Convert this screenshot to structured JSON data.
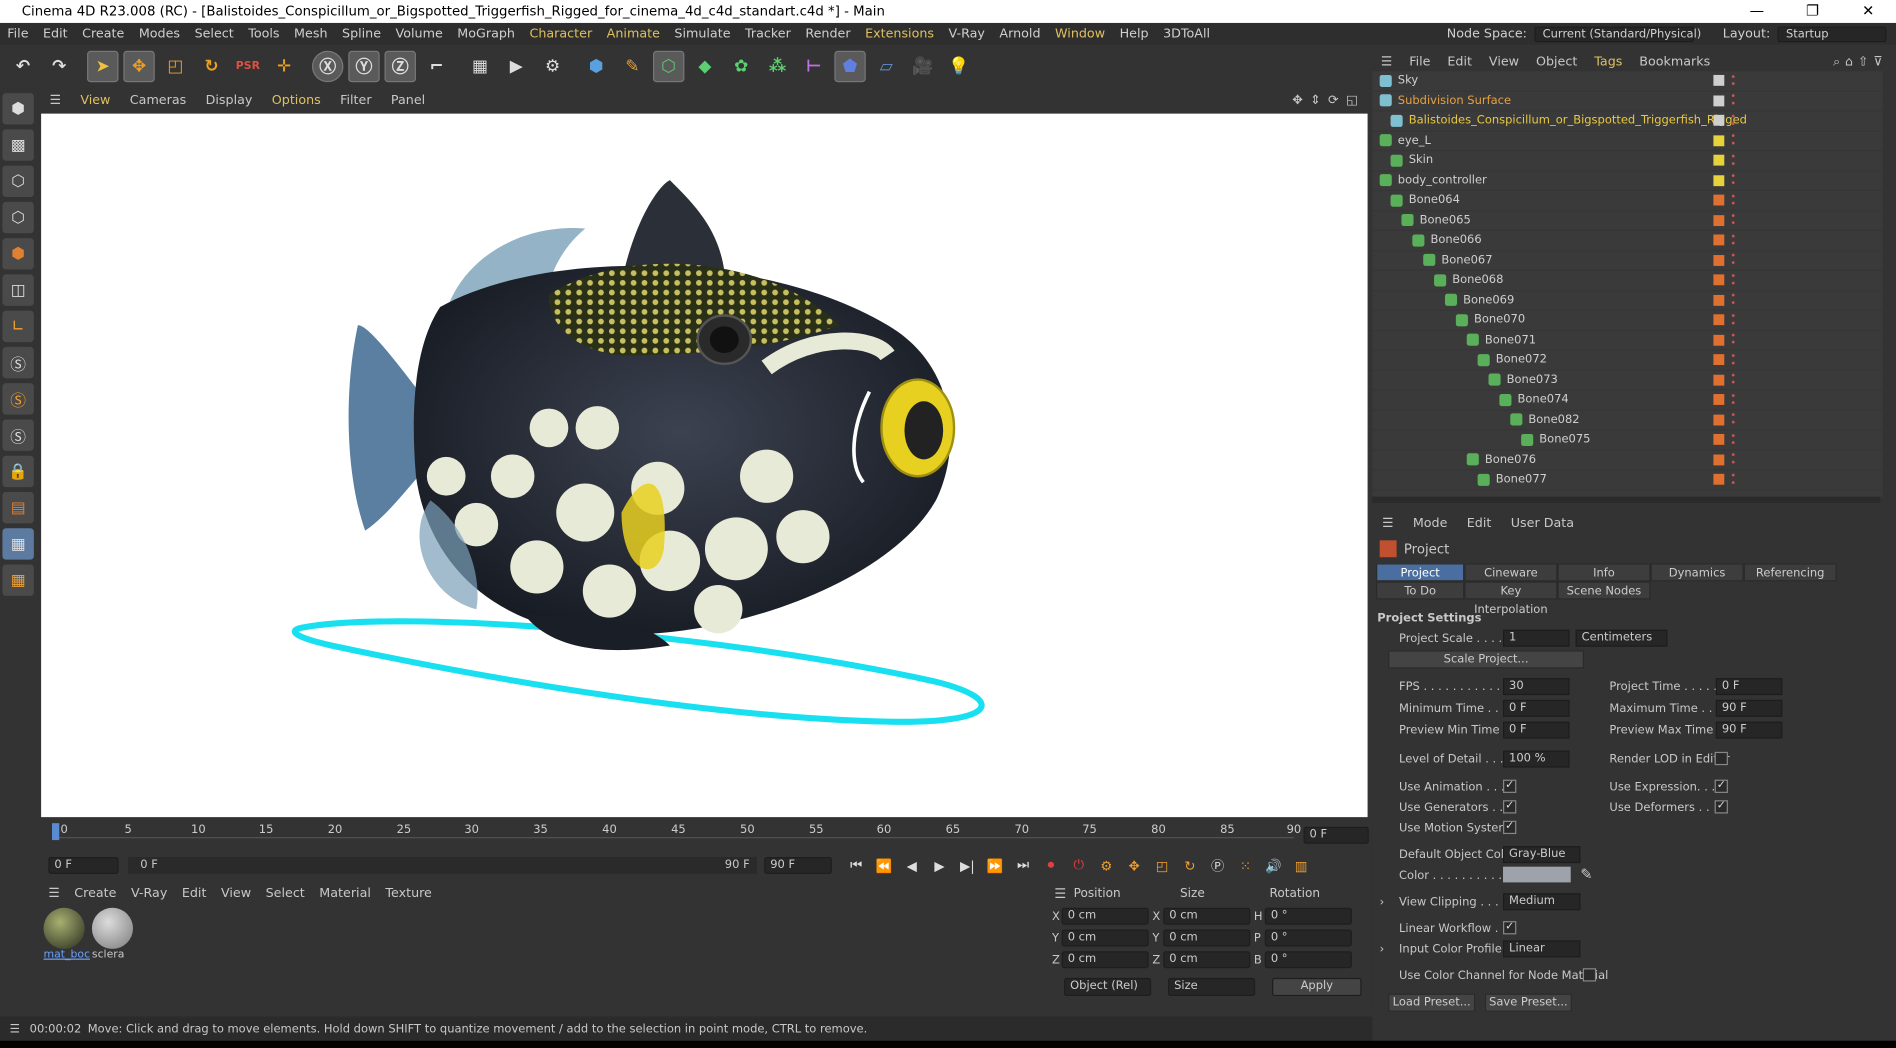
{
  "window": {
    "title": "Cinema 4D R23.008 (RC) - [Balistoides_Conspicillum_or_Bigspotted_Triggerfish_Rigged_for_cinema_4d_c4d_standart.c4d *] - Main",
    "minimize": "—",
    "restore": "❐",
    "close": "✕"
  },
  "menu": [
    "File",
    "Edit",
    "Create",
    "Modes",
    "Select",
    "Tools",
    "Mesh",
    "Spline",
    "Volume",
    "MoGraph",
    "Character",
    "Animate",
    "Simulate",
    "Tracker",
    "Render",
    "Extensions",
    "V-Ray",
    "Arnold",
    "Window",
    "Help",
    "3DToAll"
  ],
  "nodespace": {
    "label": "Node Space:",
    "value": "Current (Standard/Physical)",
    "layout_label": "Layout:",
    "layout_value": "Startup"
  },
  "viewport_menu": [
    "View",
    "Cameras",
    "Display",
    "Options",
    "Filter",
    "Panel"
  ],
  "timeline": {
    "ticks": [
      "0",
      "5",
      "10",
      "15",
      "20",
      "25",
      "30",
      "35",
      "40",
      "45",
      "50",
      "55",
      "60",
      "65",
      "70",
      "75",
      "80",
      "85",
      "90"
    ],
    "current": "0 F"
  },
  "playbar": {
    "start": "0 F",
    "range_start": "0 F",
    "range_end": "90 F",
    "end": "90 F"
  },
  "matmgr": {
    "menu": [
      "Create",
      "V-Ray",
      "Edit",
      "View",
      "Select",
      "Material",
      "Texture"
    ],
    "materials": [
      "mat_boc",
      "sclera"
    ]
  },
  "coords": {
    "headers": [
      "Position",
      "Size",
      "Rotation"
    ],
    "rows": [
      {
        "axis": "X",
        "pos": "0 cm",
        "saxis": "X",
        "size": "0 cm",
        "raxis": "H",
        "rot": "0 °"
      },
      {
        "axis": "Y",
        "pos": "0 cm",
        "saxis": "Y",
        "size": "0 cm",
        "raxis": "P",
        "rot": "0 °"
      },
      {
        "axis": "Z",
        "pos": "0 cm",
        "saxis": "Z",
        "size": "0 cm",
        "raxis": "B",
        "rot": "0 °"
      }
    ],
    "mode": "Object (Rel)",
    "size_mode": "Size",
    "apply": "Apply"
  },
  "status": {
    "time": "00:00:02",
    "message": "Move: Click and drag to move elements. Hold down SHIFT to quantize movement / add to the selection in point mode, CTRL to remove."
  },
  "objmgr": {
    "menu": [
      "File",
      "Edit",
      "View",
      "Object",
      "Tags",
      "Bookmarks"
    ],
    "items": [
      {
        "name": "Sky",
        "depth": 0,
        "color": "#cfcfcf",
        "sq": "#cfcfcf"
      },
      {
        "name": "Subdivision Surface",
        "depth": 0,
        "color": "#e8a040",
        "sq": "#cfcfcf"
      },
      {
        "name": "Balistoides_Conspicillum_or_Bigspotted_Triggerfish_Rigged",
        "depth": 1,
        "color": "#e8c840",
        "sq": "#cfcfcf"
      },
      {
        "name": "eye_L",
        "depth": 0,
        "color": "#cfcfcf",
        "sq": "#e6d23a"
      },
      {
        "name": "Skin",
        "depth": 1,
        "color": "#cfcfcf",
        "sq": "#e6d23a"
      },
      {
        "name": "body_controller",
        "depth": 0,
        "color": "#cfcfcf",
        "sq": "#e6d23a"
      },
      {
        "name": "Bone064",
        "depth": 1,
        "color": "#cfcfcf",
        "sq": "#e07030"
      },
      {
        "name": "Bone065",
        "depth": 2,
        "color": "#cfcfcf",
        "sq": "#e07030"
      },
      {
        "name": "Bone066",
        "depth": 3,
        "color": "#cfcfcf",
        "sq": "#e07030"
      },
      {
        "name": "Bone067",
        "depth": 4,
        "color": "#cfcfcf",
        "sq": "#e07030"
      },
      {
        "name": "Bone068",
        "depth": 5,
        "color": "#cfcfcf",
        "sq": "#e07030"
      },
      {
        "name": "Bone069",
        "depth": 6,
        "color": "#cfcfcf",
        "sq": "#e07030"
      },
      {
        "name": "Bone070",
        "depth": 7,
        "color": "#cfcfcf",
        "sq": "#e07030"
      },
      {
        "name": "Bone071",
        "depth": 8,
        "color": "#cfcfcf",
        "sq": "#e07030"
      },
      {
        "name": "Bone072",
        "depth": 9,
        "color": "#cfcfcf",
        "sq": "#e07030"
      },
      {
        "name": "Bone073",
        "depth": 10,
        "color": "#cfcfcf",
        "sq": "#e07030"
      },
      {
        "name": "Bone074",
        "depth": 11,
        "color": "#cfcfcf",
        "sq": "#e07030"
      },
      {
        "name": "Bone082",
        "depth": 12,
        "color": "#cfcfcf",
        "sq": "#e07030"
      },
      {
        "name": "Bone075",
        "depth": 13,
        "color": "#cfcfcf",
        "sq": "#e07030"
      },
      {
        "name": "Bone076",
        "depth": 8,
        "color": "#cfcfcf",
        "sq": "#e07030"
      },
      {
        "name": "Bone077",
        "depth": 9,
        "color": "#cfcfcf",
        "sq": "#e07030"
      }
    ]
  },
  "attr": {
    "menu": [
      "Mode",
      "Edit",
      "User Data"
    ],
    "object": "Project",
    "tabs1": [
      "Project Settings",
      "Cineware",
      "Info",
      "Dynamics",
      "Referencing"
    ],
    "tabs2": [
      "To Do",
      "Key Interpolation",
      "Scene Nodes"
    ],
    "section": "Project Settings",
    "project_scale_label": "Project Scale . . . . .",
    "project_scale": "1",
    "scale_unit": "Centimeters",
    "scale_project_btn": "Scale Project...",
    "fps_label": "FPS . . . . . . . . . . . . .",
    "fps": "30",
    "project_time_label": "Project Time . . . . .",
    "project_time": "0 F",
    "min_time_label": "Minimum Time . . .",
    "min_time": "0 F",
    "max_time_label": "Maximum Time . . .",
    "max_time": "90 F",
    "prev_min_label": "Preview Min Time . .",
    "prev_min": "0 F",
    "prev_max_label": "Preview Max Time . .",
    "prev_max": "90 F",
    "lod_label": "Level of Detail . . . .",
    "lod": "100 %",
    "render_lod_label": "Render LOD in Editor",
    "use_anim": "Use Animation . . . .",
    "use_expr": "Use Expression. . . .",
    "use_gen": "Use Generators . . .",
    "use_def": "Use Deformers . . . .",
    "use_motion": "Use Motion System",
    "def_color_label": "Default Object Color",
    "def_color": "Gray-Blue",
    "color_label": "Color . . . . . . . . . . . .",
    "view_clip_label": "View Clipping . . . .",
    "view_clip": "Medium",
    "linear_wf": "Linear Workflow . . .",
    "input_profile_label": "Input Color Profile . .",
    "input_profile": "Linear",
    "use_color_channel": "Use Color Channel for Node Material",
    "load_preset": "Load Preset...",
    "save_preset": "Save Preset..."
  }
}
